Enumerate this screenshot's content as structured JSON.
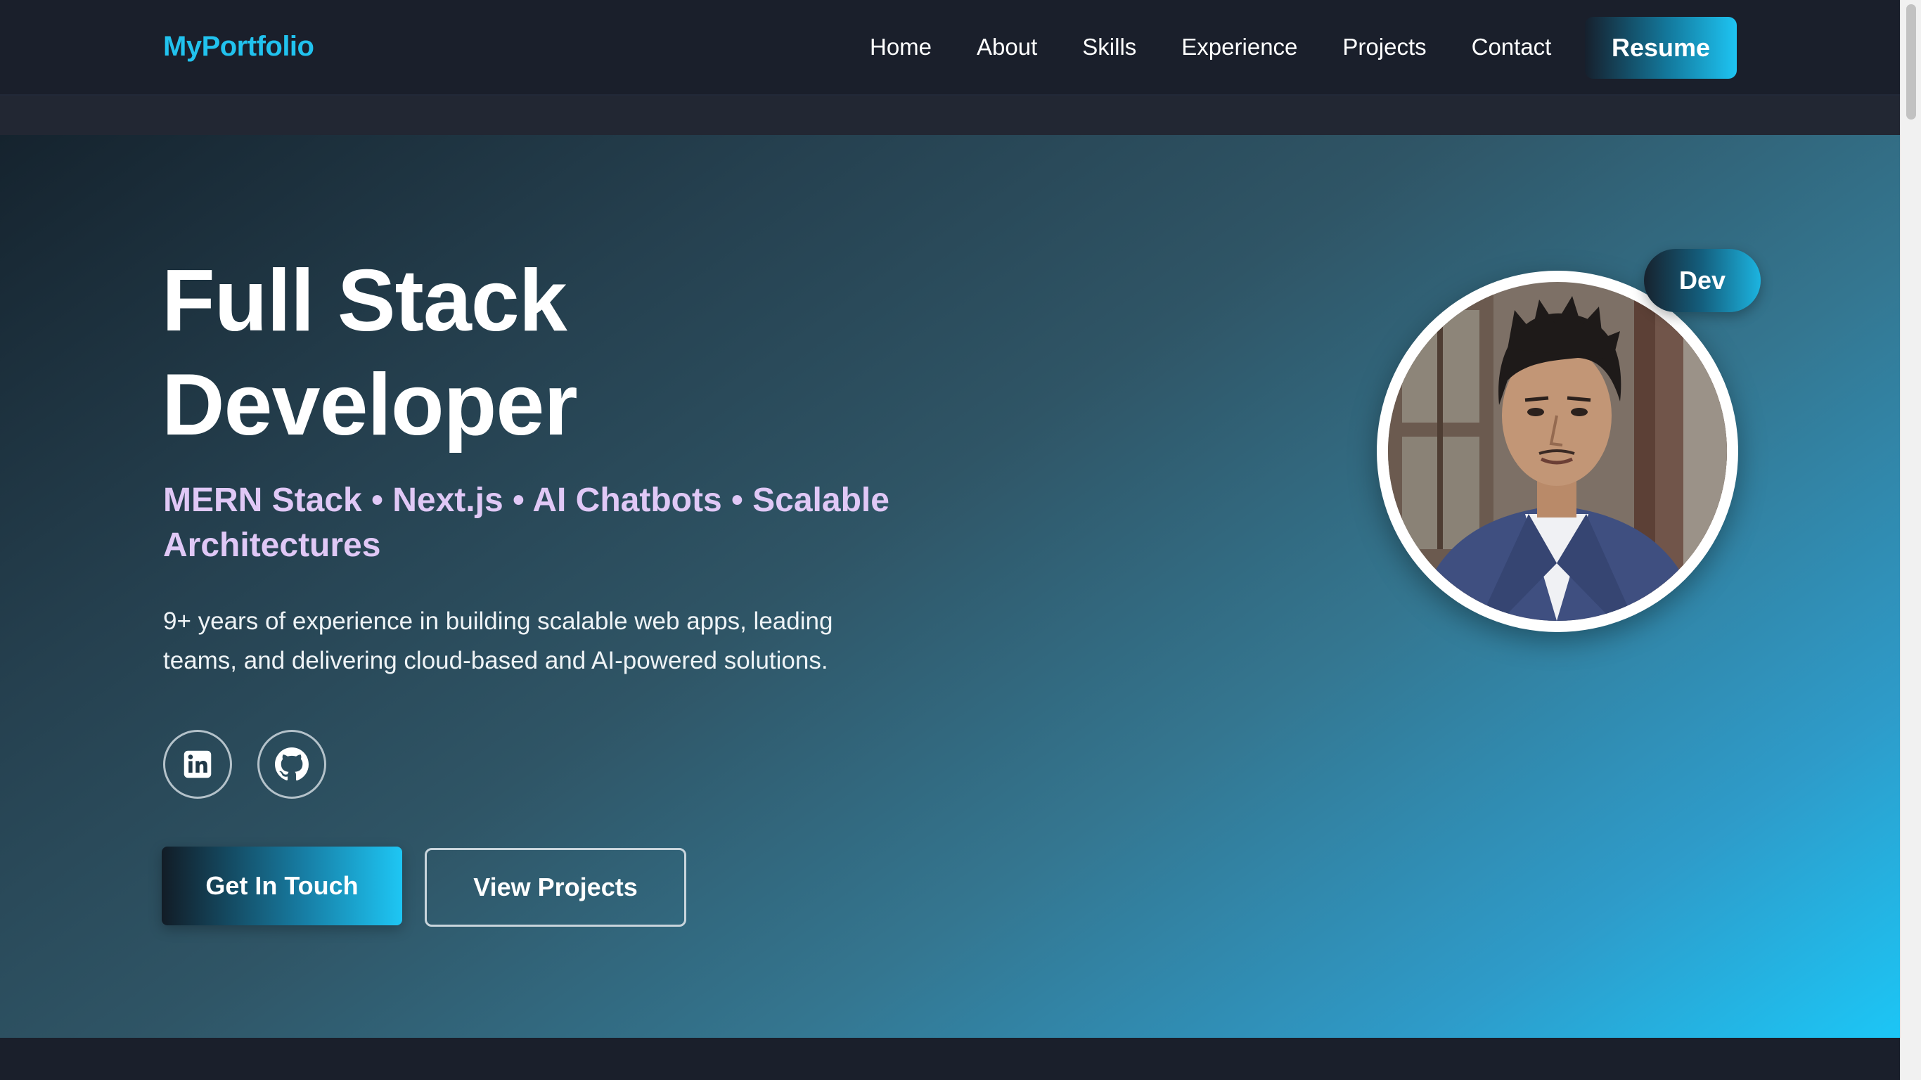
{
  "nav": {
    "brand": "MyPortfolio",
    "links": [
      "Home",
      "About",
      "Skills",
      "Experience",
      "Projects",
      "Contact"
    ],
    "resume_label": "Resume"
  },
  "hero": {
    "title_line1": "Full Stack",
    "title_line2": "Developer",
    "subtitle_line1": "MERN Stack • Next.js • AI Chatbots • Scalable",
    "subtitle_line2": "Architectures",
    "description_line1": "9+ years of experience in building scalable web apps, leading",
    "description_line2": "teams, and delivering cloud-based and AI-powered solutions.",
    "social_icons": [
      "linkedin-icon",
      "github-icon"
    ],
    "primary_cta": "Get In Touch",
    "secondary_cta": "View Projects",
    "badge": "Dev"
  },
  "colors": {
    "brand": "#21c2ee",
    "subtitle": "#e0c8f6",
    "page_bg": "#1a1f2b",
    "accent": "#1ec6f4"
  }
}
